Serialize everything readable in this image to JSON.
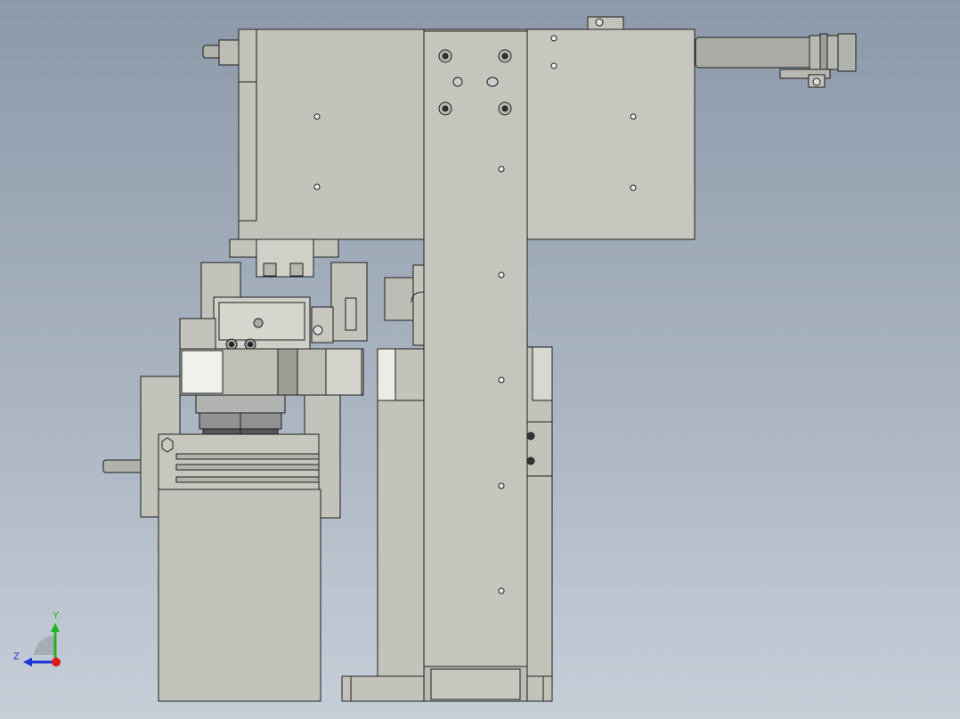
{
  "viewport": {
    "description_free": true,
    "background_top": "#8d99aa",
    "background_bottom": "#c6ced8",
    "part_fill": "#c3c3bb",
    "part_fill_dark": "#a9a9a2",
    "edge_color": "#1e1e1e"
  },
  "triad": {
    "y_label": "Y",
    "z_label": "Z",
    "y_color": "#1fb31f",
    "z_color": "#1a33d6",
    "x_color": "#e01818"
  }
}
